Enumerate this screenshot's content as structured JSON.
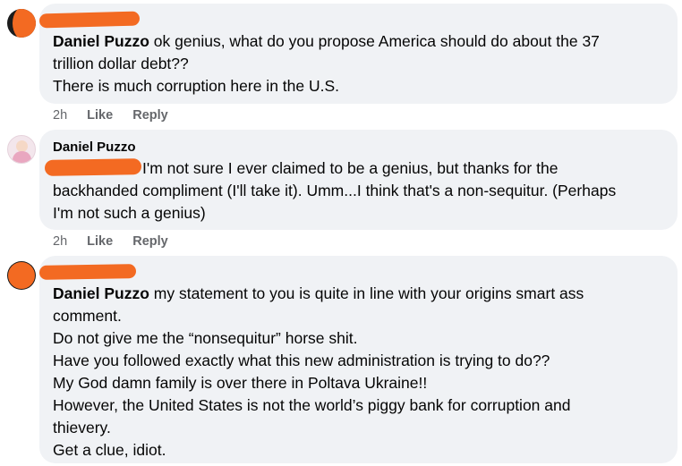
{
  "comments": [
    {
      "author": "Daniel Puzzo",
      "line1_rest": " ok genius, what do you propose America should do about the 37",
      "lines": [
        "trillion dollar debt??",
        "There is much corruption here in the U.S."
      ],
      "time": "2h",
      "like_label": "Like",
      "reply_label": "Reply"
    },
    {
      "author": "Daniel Puzzo",
      "first_line": "I'm not sure I ever claimed to be a genius, but thanks for the",
      "lines": [
        "backhanded compliment (I'll take it). Umm...I think that's a non-sequitur. (Perhaps",
        "I'm not such a genius)"
      ],
      "time": "2h",
      "like_label": "Like",
      "reply_label": "Reply"
    },
    {
      "author": "Daniel Puzzo",
      "line1_rest": " my statement to you is quite in line with your origins smart ass",
      "lines": [
        "comment.",
        "Do not give me the “nonsequitur” horse shit.",
        "Have you followed exactly what this new administration is trying to do??",
        "My God damn family is over there in Poltava Ukraine!!",
        "However, the United States is not the world’s piggy bank for corruption and",
        "thievery.",
        "Get a clue, idiot."
      ]
    }
  ],
  "colors": {
    "bubble": "#f0f2f5",
    "redaction": "#f36a22",
    "meta_text": "#65676b"
  }
}
